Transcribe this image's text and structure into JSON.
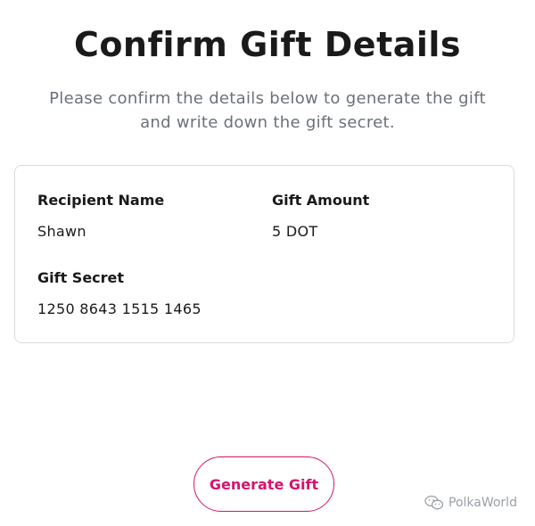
{
  "header": {
    "title": "Confirm Gift Details",
    "subtitle_line1": "Please confirm the details below to generate the gift",
    "subtitle_line2": "and write down the gift secret."
  },
  "details": {
    "recipient_label": "Recipient Name",
    "recipient_value": "Shawn",
    "amount_label": "Gift Amount",
    "amount_value": "5 DOT",
    "secret_label": "Gift Secret",
    "secret_value": "1250 8643 1515 1465"
  },
  "actions": {
    "generate_label": "Generate Gift"
  },
  "watermark": {
    "icon": "chat-bubble-icon",
    "text": "PolkaWorld"
  },
  "colors": {
    "accent": "#d6136e",
    "title": "#1a1a1a",
    "subtitle": "#6b7178",
    "card_border": "#d9dbde"
  }
}
